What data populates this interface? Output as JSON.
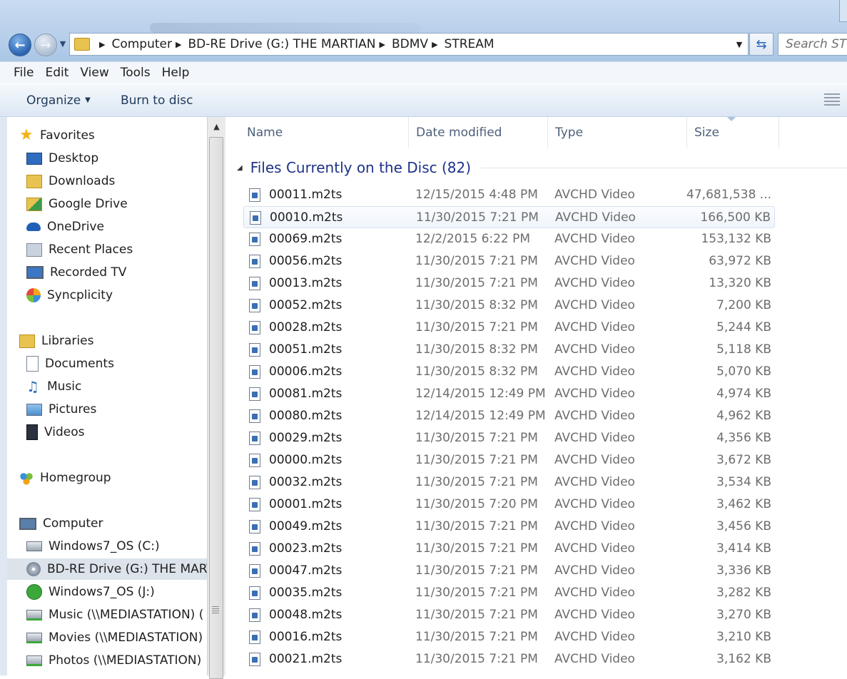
{
  "address": {
    "crumbs": [
      "Computer",
      "BD-RE Drive (G:) THE MARTIAN",
      "BDMV",
      "STREAM"
    ]
  },
  "search": {
    "placeholder": "Search STR"
  },
  "menu": {
    "items": [
      "File",
      "Edit",
      "View",
      "Tools",
      "Help"
    ]
  },
  "commands": {
    "organize": "Organize",
    "burn": "Burn to disc"
  },
  "nav": {
    "favorites": "Favorites",
    "favorites_items": [
      "Desktop",
      "Downloads",
      "Google Drive",
      "OneDrive",
      "Recent Places",
      "Recorded TV",
      "Syncplicity"
    ],
    "libraries": "Libraries",
    "libraries_items": [
      "Documents",
      "Music",
      "Pictures",
      "Videos"
    ],
    "homegroup": "Homegroup",
    "computer": "Computer",
    "computer_items": [
      "Windows7_OS (C:)",
      "BD-RE Drive (G:) THE MARTIAN",
      "Windows7_OS (J:)",
      "Music (\\\\MEDIASTATION) (",
      "Movies (\\\\MEDIASTATION)",
      "Photos (\\\\MEDIASTATION)"
    ]
  },
  "columns": {
    "name": "Name",
    "date": "Date modified",
    "type": "Type",
    "size": "Size"
  },
  "group": {
    "title": "Files Currently on the Disc (82)"
  },
  "files": [
    {
      "name": "00011.m2ts",
      "date": "12/15/2015 4:48 PM",
      "type": "AVCHD Video",
      "size": "47,681,538 ..."
    },
    {
      "name": "00010.m2ts",
      "date": "11/30/2015 7:21 PM",
      "type": "AVCHD Video",
      "size": "166,500 KB"
    },
    {
      "name": "00069.m2ts",
      "date": "12/2/2015 6:22 PM",
      "type": "AVCHD Video",
      "size": "153,132 KB"
    },
    {
      "name": "00056.m2ts",
      "date": "11/30/2015 7:21 PM",
      "type": "AVCHD Video",
      "size": "63,972 KB"
    },
    {
      "name": "00013.m2ts",
      "date": "11/30/2015 7:21 PM",
      "type": "AVCHD Video",
      "size": "13,320 KB"
    },
    {
      "name": "00052.m2ts",
      "date": "11/30/2015 8:32 PM",
      "type": "AVCHD Video",
      "size": "7,200 KB"
    },
    {
      "name": "00028.m2ts",
      "date": "11/30/2015 7:21 PM",
      "type": "AVCHD Video",
      "size": "5,244 KB"
    },
    {
      "name": "00051.m2ts",
      "date": "11/30/2015 8:32 PM",
      "type": "AVCHD Video",
      "size": "5,118 KB"
    },
    {
      "name": "00006.m2ts",
      "date": "11/30/2015 8:32 PM",
      "type": "AVCHD Video",
      "size": "5,070 KB"
    },
    {
      "name": "00081.m2ts",
      "date": "12/14/2015 12:49 PM",
      "type": "AVCHD Video",
      "size": "4,974 KB"
    },
    {
      "name": "00080.m2ts",
      "date": "12/14/2015 12:49 PM",
      "type": "AVCHD Video",
      "size": "4,962 KB"
    },
    {
      "name": "00029.m2ts",
      "date": "11/30/2015 7:21 PM",
      "type": "AVCHD Video",
      "size": "4,356 KB"
    },
    {
      "name": "00000.m2ts",
      "date": "11/30/2015 7:21 PM",
      "type": "AVCHD Video",
      "size": "3,672 KB"
    },
    {
      "name": "00032.m2ts",
      "date": "11/30/2015 7:21 PM",
      "type": "AVCHD Video",
      "size": "3,534 KB"
    },
    {
      "name": "00001.m2ts",
      "date": "11/30/2015 7:20 PM",
      "type": "AVCHD Video",
      "size": "3,462 KB"
    },
    {
      "name": "00049.m2ts",
      "date": "11/30/2015 7:21 PM",
      "type": "AVCHD Video",
      "size": "3,456 KB"
    },
    {
      "name": "00023.m2ts",
      "date": "11/30/2015 7:21 PM",
      "type": "AVCHD Video",
      "size": "3,414 KB"
    },
    {
      "name": "00047.m2ts",
      "date": "11/30/2015 7:21 PM",
      "type": "AVCHD Video",
      "size": "3,336 KB"
    },
    {
      "name": "00035.m2ts",
      "date": "11/30/2015 7:21 PM",
      "type": "AVCHD Video",
      "size": "3,282 KB"
    },
    {
      "name": "00048.m2ts",
      "date": "11/30/2015 7:21 PM",
      "type": "AVCHD Video",
      "size": "3,270 KB"
    },
    {
      "name": "00016.m2ts",
      "date": "11/30/2015 7:21 PM",
      "type": "AVCHD Video",
      "size": "3,210 KB"
    },
    {
      "name": "00021.m2ts",
      "date": "11/30/2015 7:21 PM",
      "type": "AVCHD Video",
      "size": "3,162 KB"
    }
  ]
}
